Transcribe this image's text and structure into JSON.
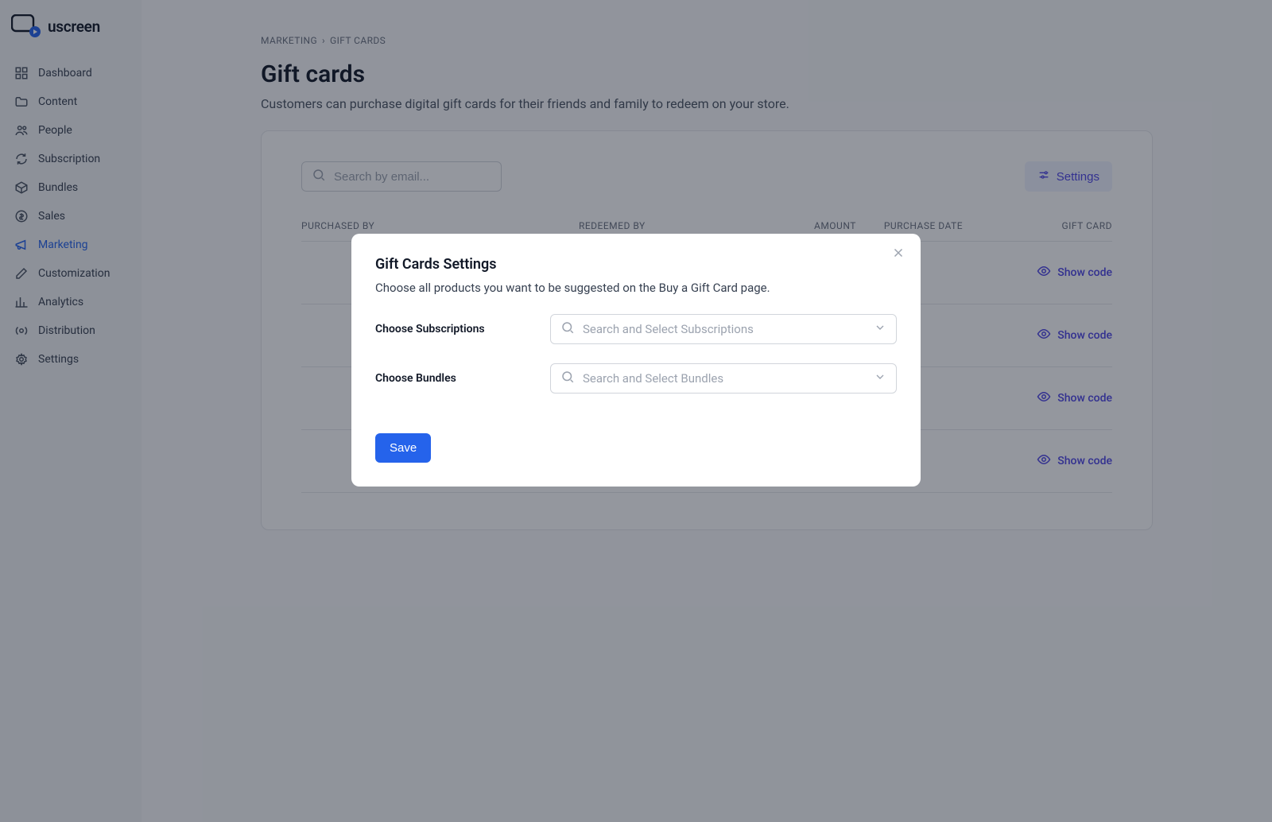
{
  "brand": {
    "name": "uscreen"
  },
  "sidebar": {
    "items": [
      {
        "label": "Dashboard"
      },
      {
        "label": "Content"
      },
      {
        "label": "People"
      },
      {
        "label": "Subscription"
      },
      {
        "label": "Bundles"
      },
      {
        "label": "Sales"
      },
      {
        "label": "Marketing"
      },
      {
        "label": "Customization"
      },
      {
        "label": "Analytics"
      },
      {
        "label": "Distribution"
      },
      {
        "label": "Settings"
      }
    ]
  },
  "breadcrumb": {
    "parent": "MARKETING",
    "sep": "›",
    "current": "GIFT CARDS"
  },
  "page": {
    "title": "Gift cards",
    "description": "Customers can purchase digital gift cards for their friends and family to redeem on your store."
  },
  "search": {
    "placeholder": "Search by email..."
  },
  "settings_button": "Settings",
  "columns": {
    "purchased_by": "PURCHASED BY",
    "redeemed_by": "REDEEMED BY",
    "amount": "AMOUNT",
    "purchase_date": "PURCHASE DATE",
    "gift_card": "GIFT CARD"
  },
  "row_action": "Show code",
  "modal": {
    "title": "Gift Cards Settings",
    "description": "Choose all products you want to be suggested on the Buy a Gift Card page.",
    "subs_label": "Choose Subscriptions",
    "subs_placeholder": "Search and Select Subscriptions",
    "bundles_label": "Choose Bundles",
    "bundles_placeholder": "Search and Select Bundles",
    "save": "Save"
  }
}
